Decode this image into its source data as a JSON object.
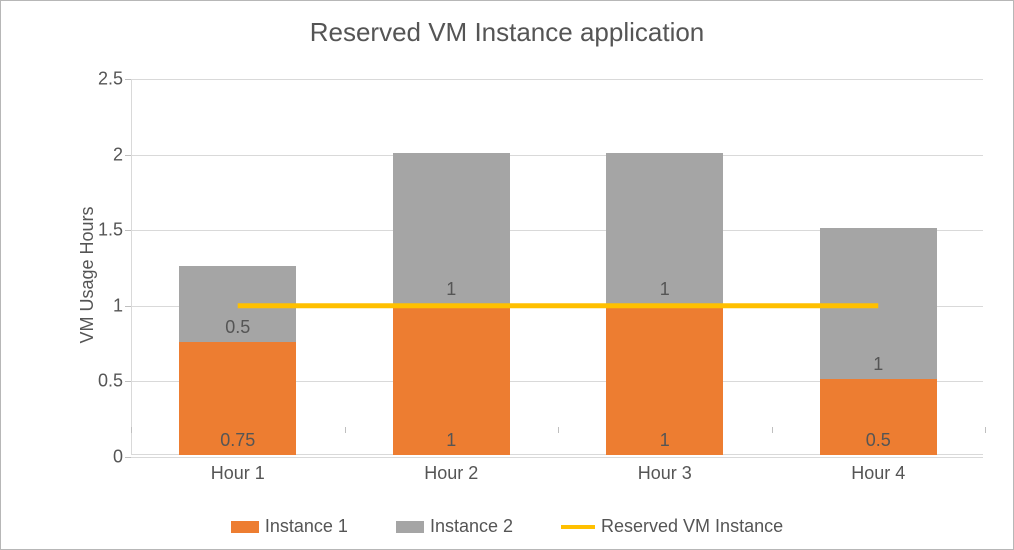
{
  "chart_data": {
    "type": "bar",
    "title": "Reserved VM Instance application",
    "xlabel": "",
    "ylabel": "VM Usage Hours",
    "categories": [
      "Hour 1",
      "Hour 2",
      "Hour 3",
      "Hour 4"
    ],
    "series": [
      {
        "name": "Instance 1",
        "values": [
          0.75,
          1,
          1,
          0.5
        ],
        "color": "#ed7d31"
      },
      {
        "name": "Instance 2",
        "values": [
          0.5,
          1,
          1,
          1
        ],
        "color": "#a5a5a5"
      },
      {
        "name": "Reserved VM Instance",
        "values": [
          1,
          1,
          1,
          1
        ],
        "color": "#ffc000",
        "render": "line"
      }
    ],
    "stacked": true,
    "ylim": [
      0,
      2.5
    ],
    "y_ticks": [
      0,
      0.5,
      1,
      1.5,
      2,
      2.5
    ],
    "legend_position": "bottom",
    "grid": "horizontal"
  },
  "colors": {
    "instance1": "#ed7d31",
    "instance2": "#a5a5a5",
    "reserved": "#ffc000",
    "axis": "#d9d9d9",
    "text": "#595959"
  }
}
